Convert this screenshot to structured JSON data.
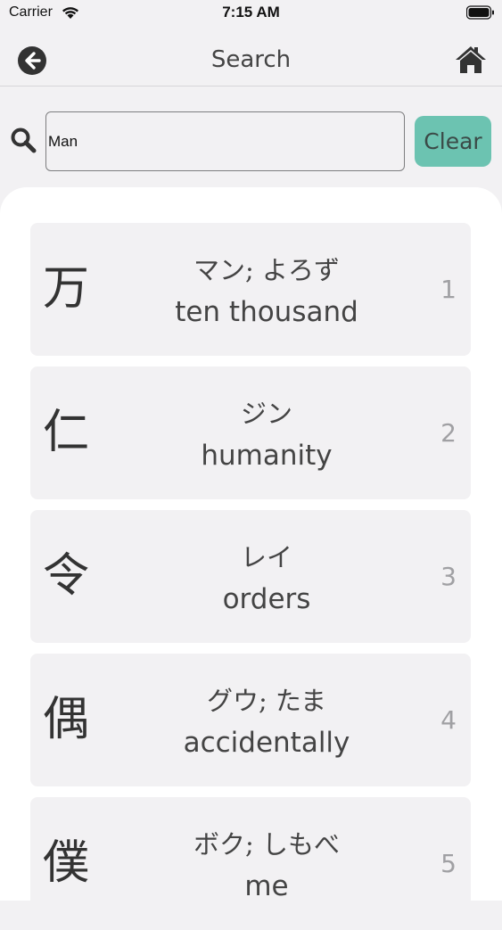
{
  "status_bar": {
    "carrier": "Carrier",
    "time": "7:15 AM"
  },
  "nav": {
    "title": "Search",
    "back_icon": "arrow-left-circle-icon",
    "home_icon": "home-icon"
  },
  "search": {
    "icon": "search-icon",
    "value": "Man",
    "placeholder": "",
    "clear_label": "Clear"
  },
  "colors": {
    "accent": "#6cc3b1",
    "card_bg": "#f2f1f3",
    "panel_bg": "#ffffff"
  },
  "results": [
    {
      "kanji": "万",
      "reading": "マン; よろず",
      "meaning": "ten thousand",
      "index": "1"
    },
    {
      "kanji": "仁",
      "reading": "ジン",
      "meaning": "humanity",
      "index": "2"
    },
    {
      "kanji": "令",
      "reading": "レイ",
      "meaning": "orders",
      "index": "3"
    },
    {
      "kanji": "偶",
      "reading": "グウ; たま",
      "meaning": "accidentally",
      "index": "4"
    },
    {
      "kanji": "僕",
      "reading": "ボク; しもべ",
      "meaning": "me",
      "index": "5"
    }
  ]
}
